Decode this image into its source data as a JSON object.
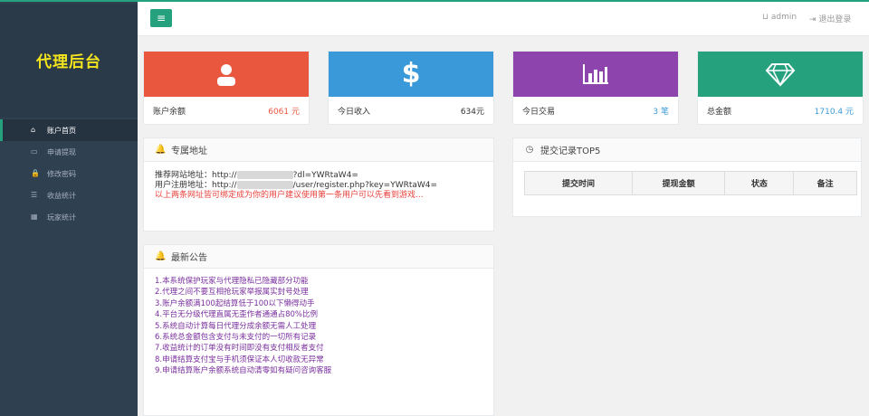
{
  "header": {
    "user": "admin",
    "logout": "退出登录"
  },
  "sidebar": {
    "brand": "代理后台",
    "items": [
      {
        "label": "账户首页",
        "icon": "home-icon",
        "active": true
      },
      {
        "label": "申请提现",
        "icon": "card-icon"
      },
      {
        "label": "修改密码",
        "icon": "lock-icon"
      },
      {
        "label": "收益统计",
        "icon": "list-icon"
      },
      {
        "label": "玩家统计",
        "icon": "calc-icon"
      }
    ]
  },
  "stats": [
    {
      "label": "账户余额",
      "value": "6061 元",
      "color": "#e9573f",
      "icon": "user-icon",
      "value_color": "#e9573f"
    },
    {
      "label": "今日收入",
      "value": "634元",
      "color": "#3a9ad9",
      "icon": "dollar-icon",
      "value_color": "#333333"
    },
    {
      "label": "今日交易",
      "value": "3 笔",
      "color": "#8e44ad",
      "icon": "bar-chart-icon",
      "value_color": "#3a9ad9"
    },
    {
      "label": "总金额",
      "value": "1710.4 元",
      "color": "#26a17e",
      "icon": "diamond-icon",
      "value_color": "#3a9ad9"
    }
  ],
  "address": {
    "title": "专属地址",
    "line1_prefix": "推荐网站地址：http://",
    "line1_suffix": "?dl=YWRtaW4=",
    "line2_prefix": "用户注册地址：http://",
    "line2_suffix": "/user/register.php?key=YWRtaW4=",
    "warning": "以上两条网址皆可绑定成为你的用户建议使用第一条用户可以先看到游戏..."
  },
  "top5": {
    "title": "提交记录TOP5",
    "columns": [
      "提交时间",
      "提现金额",
      "状态",
      "备注"
    ]
  },
  "notice": {
    "title": "最新公告",
    "items": [
      "1.本系统保护玩家与代理隐私已隐藏部分功能",
      "2.代理之间不要互相抢玩家举报属实封号处理",
      "3.账户余额满100起结算低于100以下懒得动手",
      "4.平台无分级代理直属无歪作者通通占80%比例",
      "5.系统自动计算每日代理分成余额无需人工处理",
      "6.系统总金额包含支付与未支付的一切所有记录",
      "7.收益统计的订单没有时间即没有支付相反者支付",
      "8.申请结算支付宝与手机须保证本人切收款无异常",
      "9.申请结算账户余额系统自动清零如有疑问咨询客服"
    ]
  }
}
